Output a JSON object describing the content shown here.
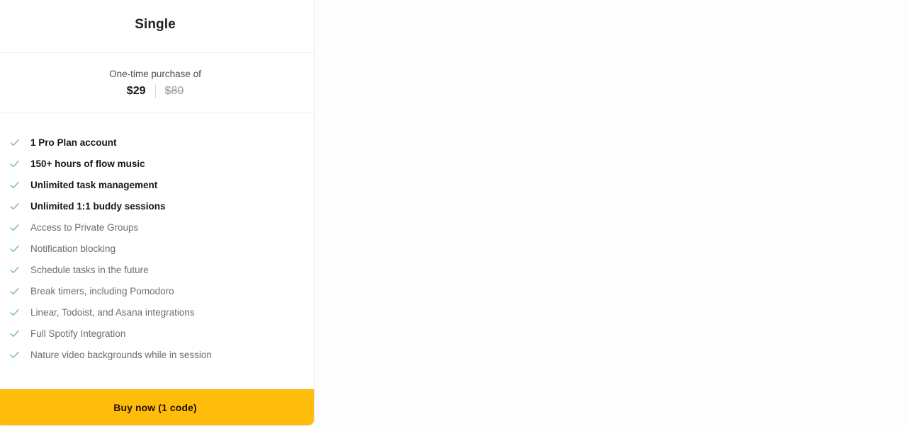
{
  "card": {
    "plan_title": "Single",
    "price": {
      "caption": "One-time purchase of",
      "current": "$29",
      "original": "$80"
    },
    "features": [
      {
        "label": "1 Pro Plan account",
        "highlight": true
      },
      {
        "label": "150+ hours of flow music",
        "highlight": true
      },
      {
        "label": "Unlimited task management",
        "highlight": true
      },
      {
        "label": "Unlimited 1:1 buddy sessions",
        "highlight": true
      },
      {
        "label": "Access to Private Groups",
        "highlight": false
      },
      {
        "label": "Notification blocking",
        "highlight": false
      },
      {
        "label": "Schedule tasks in the future",
        "highlight": false
      },
      {
        "label": "Break timers, including Pomodoro",
        "highlight": false
      },
      {
        "label": "Linear, Todoist, and Asana integrations",
        "highlight": false
      },
      {
        "label": "Full Spotify Integration",
        "highlight": false
      },
      {
        "label": "Nature video backgrounds while in session",
        "highlight": false
      }
    ],
    "feature_icon": "check-icon",
    "buy_button_label": "Buy now (1 code)"
  },
  "colors": {
    "accent": "#ffbc0b",
    "check": "#7bc67e",
    "page_background": "#fdfdfd",
    "card_background": "#ffffff",
    "border": "#ededed",
    "muted_text": "#6d6d6d",
    "strong_text": "#161616"
  }
}
